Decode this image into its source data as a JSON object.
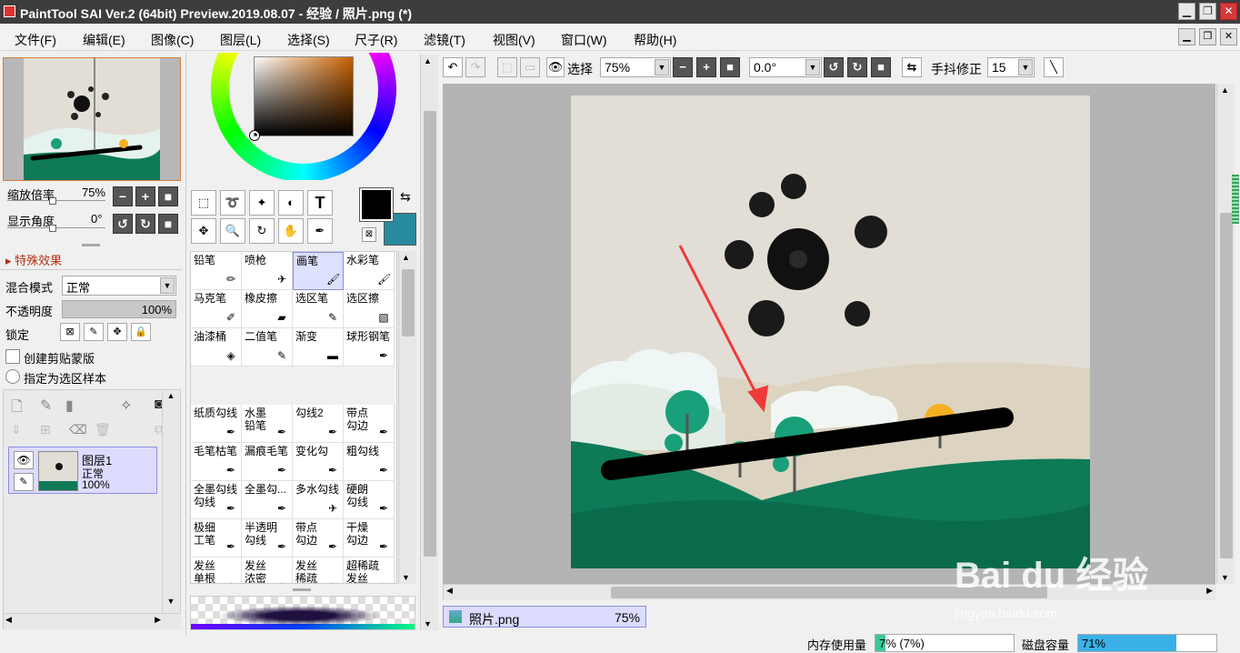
{
  "window": {
    "title": "PaintTool SAI Ver.2 (64bit) Preview.2019.08.07 - 经验 / 照片.png (*)",
    "minimize": "▁",
    "restore": "❐",
    "close": "✕"
  },
  "menubar": {
    "items": [
      "文件(F)",
      "编辑(E)",
      "图像(C)",
      "图层(L)",
      "选择(S)",
      "尺子(R)",
      "滤镜(T)",
      "视图(V)",
      "窗口(W)",
      "帮助(H)"
    ]
  },
  "navigator": {
    "zoom_label": "缩放倍率",
    "zoom_value": "75%",
    "angle_label": "显示角度",
    "angle_value": "0°"
  },
  "layer_panel": {
    "effects_label": "特殊效果",
    "blend_label": "混合模式",
    "blend_value": "正常",
    "opacity_label": "不透明度",
    "opacity_value": "100%",
    "opacity_fill": 1.0,
    "lock_label": "锁定",
    "clip_label": "创建剪贴蒙版",
    "sample_label": "指定为选区样本",
    "layer": {
      "name": "图层1",
      "mode": "正常",
      "opacity": "100%"
    }
  },
  "tools": {
    "text_tool": "T"
  },
  "brushes": [
    {
      "label": "铅笔",
      "icon": "pencil-icon"
    },
    {
      "label": "喷枪",
      "icon": "airbrush-icon"
    },
    {
      "label": "画笔",
      "icon": "brush-icon",
      "selected": true
    },
    {
      "label": "水彩笔",
      "icon": "watercolor-icon"
    },
    {
      "label": "马克笔",
      "icon": "marker-icon"
    },
    {
      "label": "橡皮擦",
      "icon": "eraser-icon"
    },
    {
      "label": "选区笔",
      "icon": "selpen-icon"
    },
    {
      "label": "选区擦",
      "icon": "selerase-icon"
    },
    {
      "label": "油漆桶",
      "icon": "bucket-icon"
    },
    {
      "label": "二值笔",
      "icon": "binary-pen-icon"
    },
    {
      "label": "渐变",
      "icon": "gradient-icon"
    },
    {
      "label": "球形钢笔",
      "icon": "ballpen-icon"
    },
    {
      "label": "",
      "icon": ""
    },
    {
      "label": "",
      "icon": ""
    },
    {
      "label": "",
      "icon": ""
    },
    {
      "label": "",
      "icon": ""
    },
    {
      "label": "纸质勾线",
      "icon": "pen-icon"
    },
    {
      "label": "水墨\n铅笔",
      "icon": "pen-icon"
    },
    {
      "label": "勾线2",
      "icon": "pen-icon"
    },
    {
      "label": "带点\n勾边",
      "icon": "pen-icon"
    },
    {
      "label": "毛笔枯笔",
      "icon": "pen-icon"
    },
    {
      "label": "漏痕毛笔",
      "icon": "pen-icon"
    },
    {
      "label": "变化勾",
      "icon": "pen-icon"
    },
    {
      "label": "粗勾线",
      "icon": "pen-icon"
    },
    {
      "label": "全墨勾线\n勾线",
      "icon": "pen-icon"
    },
    {
      "label": "全墨勾...",
      "icon": "pen-icon"
    },
    {
      "label": "多水勾线",
      "icon": "airbrush-icon"
    },
    {
      "label": "硬朗\n勾线",
      "icon": "pen-icon"
    },
    {
      "label": "极细\n工笔",
      "icon": "pen-icon"
    },
    {
      "label": "半透明\n勾线",
      "icon": "pen-icon"
    },
    {
      "label": "带点\n勾边",
      "icon": "pen-icon"
    },
    {
      "label": "干燥\n勾边",
      "icon": "pen-icon"
    },
    {
      "label": "发丝\n单根",
      "icon": "pen-icon"
    },
    {
      "label": "发丝\n浓密",
      "icon": "pen-icon"
    },
    {
      "label": "发丝\n稀疏",
      "icon": "pen-icon"
    },
    {
      "label": "超稀疏\n发丝",
      "icon": "pen-icon"
    }
  ],
  "toolbar": {
    "select_label": "选择",
    "zoom_value": "75%",
    "rotation_value": "0.0°",
    "stabilizer_label": "手抖修正",
    "stabilizer_value": "15"
  },
  "document_tab": {
    "name": "照片.png",
    "zoom": "75%"
  },
  "status": {
    "memory_label": "内存使用量",
    "memory_value": "7% (7%)",
    "memory_fill": 0.07,
    "disk_label": "磁盘容量",
    "disk_value": "71%",
    "disk_fill": 0.71
  },
  "watermark": {
    "brand": "Bai du 经验",
    "url": "jingyan.baidu.com"
  },
  "colors": {
    "foreground": "#000000",
    "background": "#2a8aa0",
    "canvas_bg": "#e2ded6",
    "green": "#0e7a58",
    "accent": "#ef3a3a"
  }
}
